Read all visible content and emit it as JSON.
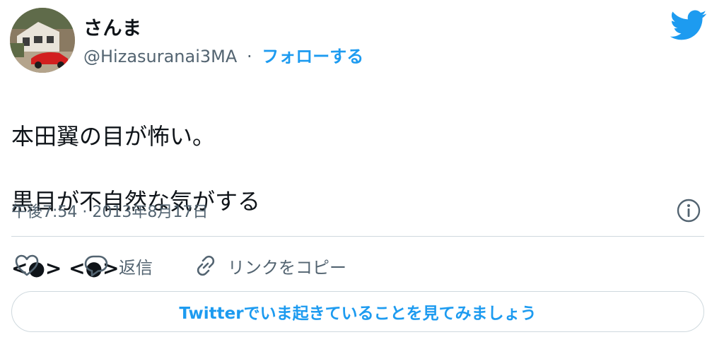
{
  "author": {
    "display_name": "さんま",
    "handle": "@Hizasuranai3MA",
    "separator": "·",
    "follow_label": "フォローする",
    "avatar_icon": "profile-photo-house-red-car"
  },
  "brand": {
    "logo_icon": "twitter-bird-icon",
    "accent_color": "#1d9bf0"
  },
  "tweet": {
    "lines": [
      "本田翼の目が怖い。",
      "黒目が不自然な気がする",
      "<●> <●>"
    ],
    "timestamp": "午後7:54 · 2013年8月17日"
  },
  "actions": {
    "like_icon": "heart-icon",
    "reply_label": "返信",
    "reply_icon": "speech-bubble-icon",
    "copy_link_label": "リンクをコピー",
    "copy_link_icon": "link-icon",
    "info_icon": "info-icon"
  },
  "cta": {
    "label": "Twitterでいま起きていることを見てみましょう"
  }
}
